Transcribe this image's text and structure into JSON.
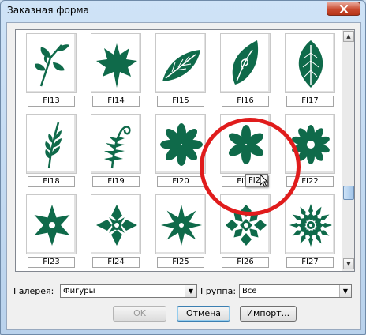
{
  "window": {
    "title": "Заказная форма",
    "close_icon": "close-x-icon"
  },
  "shape_color": "#0f6a4a",
  "tiles": [
    {
      "label": "FI13",
      "icon": "leafy-sprig-icon"
    },
    {
      "label": "FI14",
      "icon": "maple-leaf-icon"
    },
    {
      "label": "FI15",
      "icon": "tilted-leaf-icon"
    },
    {
      "label": "FI16",
      "icon": "curled-leaf-icon"
    },
    {
      "label": "FI17",
      "icon": "elm-leaf-icon"
    },
    {
      "label": "FI18",
      "icon": "fern-stalk-icon"
    },
    {
      "label": "FI19",
      "icon": "fiddlehead-fern-icon"
    },
    {
      "label": "FI20",
      "icon": "eight-petal-flower-icon"
    },
    {
      "label": "FI21",
      "icon": "six-petal-flower-icon"
    },
    {
      "label": "FI22",
      "icon": "daisy-flower-icon"
    },
    {
      "label": "FI23",
      "icon": "ornament-star-icon"
    },
    {
      "label": "FI24",
      "icon": "diamond-star-icon"
    },
    {
      "label": "FI25",
      "icon": "eight-point-star-icon"
    },
    {
      "label": "FI26",
      "icon": "snowflake-ornament-icon"
    },
    {
      "label": "FI27",
      "icon": "snowflake-burst-icon"
    }
  ],
  "tooltip": "FI21",
  "gallery_label": "Галерея:",
  "gallery_value": "Фигуры",
  "group_label": "Группа:",
  "group_value": "Все",
  "buttons": {
    "ok": "OK",
    "cancel": "Отмена",
    "import": "Импорт..."
  }
}
